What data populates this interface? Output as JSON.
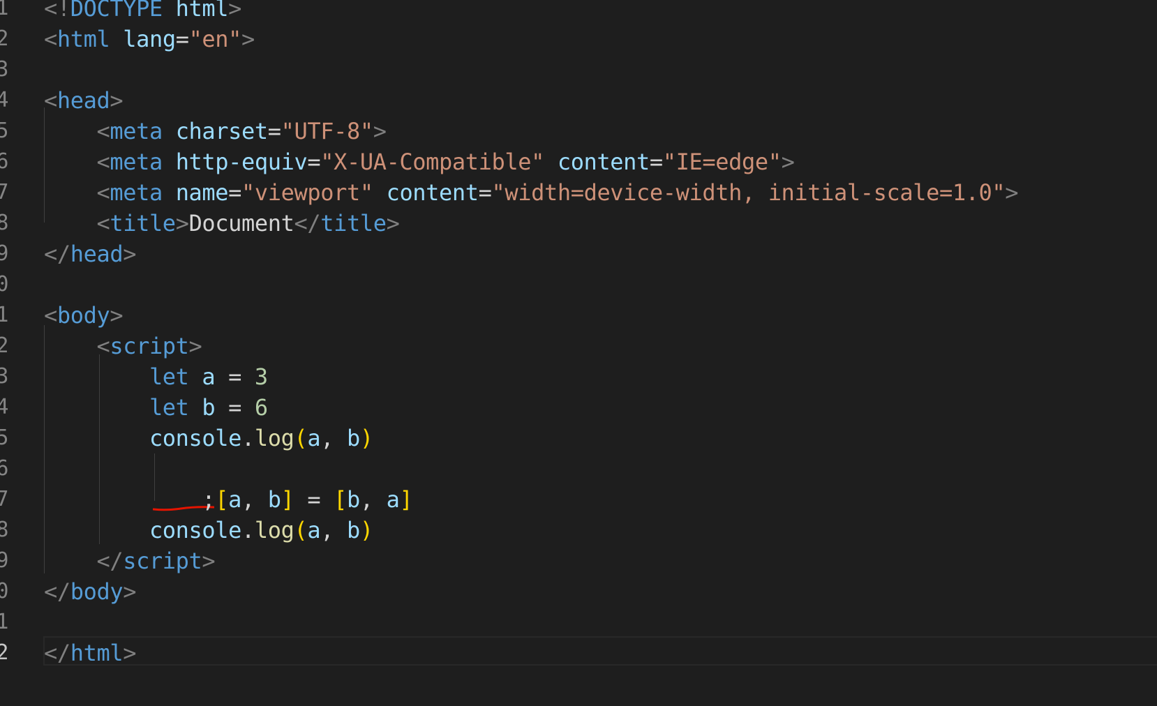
{
  "editor": {
    "active_line": "22",
    "line_numbers": [
      "1",
      "2",
      "3",
      "4",
      "5",
      "6",
      "7",
      "8",
      "9",
      "0",
      "1",
      "2",
      "3",
      "4",
      "5",
      "6",
      "7",
      "8",
      "9",
      "0",
      "1",
      "2"
    ],
    "lines": [
      [
        {
          "t": "<!",
          "c": "punc"
        },
        {
          "t": "DOCTYPE",
          "c": "tag"
        },
        {
          "t": " ",
          "c": "text"
        },
        {
          "t": "html",
          "c": "attr"
        },
        {
          "t": ">",
          "c": "punc"
        }
      ],
      [
        {
          "t": "<",
          "c": "punc"
        },
        {
          "t": "html",
          "c": "tag"
        },
        {
          "t": " ",
          "c": "text"
        },
        {
          "t": "lang",
          "c": "attr"
        },
        {
          "t": "=",
          "c": "text"
        },
        {
          "t": "\"en\"",
          "c": "str"
        },
        {
          "t": ">",
          "c": "punc"
        }
      ],
      [],
      [
        {
          "t": "<",
          "c": "punc"
        },
        {
          "t": "head",
          "c": "tag"
        },
        {
          "t": ">",
          "c": "punc"
        }
      ],
      [
        {
          "t": "    ",
          "c": "text"
        },
        {
          "t": "<",
          "c": "punc"
        },
        {
          "t": "meta",
          "c": "tag"
        },
        {
          "t": " ",
          "c": "text"
        },
        {
          "t": "charset",
          "c": "attr"
        },
        {
          "t": "=",
          "c": "text"
        },
        {
          "t": "\"UTF-8\"",
          "c": "str"
        },
        {
          "t": ">",
          "c": "punc"
        }
      ],
      [
        {
          "t": "    ",
          "c": "text"
        },
        {
          "t": "<",
          "c": "punc"
        },
        {
          "t": "meta",
          "c": "tag"
        },
        {
          "t": " ",
          "c": "text"
        },
        {
          "t": "http-equiv",
          "c": "attr"
        },
        {
          "t": "=",
          "c": "text"
        },
        {
          "t": "\"X-UA-Compatible\"",
          "c": "str"
        },
        {
          "t": " ",
          "c": "text"
        },
        {
          "t": "content",
          "c": "attr"
        },
        {
          "t": "=",
          "c": "text"
        },
        {
          "t": "\"IE=edge\"",
          "c": "str"
        },
        {
          "t": ">",
          "c": "punc"
        }
      ],
      [
        {
          "t": "    ",
          "c": "text"
        },
        {
          "t": "<",
          "c": "punc"
        },
        {
          "t": "meta",
          "c": "tag"
        },
        {
          "t": " ",
          "c": "text"
        },
        {
          "t": "name",
          "c": "attr"
        },
        {
          "t": "=",
          "c": "text"
        },
        {
          "t": "\"viewport\"",
          "c": "str"
        },
        {
          "t": " ",
          "c": "text"
        },
        {
          "t": "content",
          "c": "attr"
        },
        {
          "t": "=",
          "c": "text"
        },
        {
          "t": "\"width=device-width, initial-scale=1.0\"",
          "c": "str"
        },
        {
          "t": ">",
          "c": "punc"
        }
      ],
      [
        {
          "t": "    ",
          "c": "text"
        },
        {
          "t": "<",
          "c": "punc"
        },
        {
          "t": "title",
          "c": "tag"
        },
        {
          "t": ">",
          "c": "punc"
        },
        {
          "t": "Document",
          "c": "text"
        },
        {
          "t": "</",
          "c": "punc"
        },
        {
          "t": "title",
          "c": "tag"
        },
        {
          "t": ">",
          "c": "punc"
        }
      ],
      [
        {
          "t": "</",
          "c": "punc"
        },
        {
          "t": "head",
          "c": "tag"
        },
        {
          "t": ">",
          "c": "punc"
        }
      ],
      [],
      [
        {
          "t": "<",
          "c": "punc"
        },
        {
          "t": "body",
          "c": "tag"
        },
        {
          "t": ">",
          "c": "punc"
        }
      ],
      [
        {
          "t": "    ",
          "c": "text"
        },
        {
          "t": "<",
          "c": "punc"
        },
        {
          "t": "script",
          "c": "tag"
        },
        {
          "t": ">",
          "c": "punc"
        }
      ],
      [
        {
          "t": "        ",
          "c": "text"
        },
        {
          "t": "let",
          "c": "kw"
        },
        {
          "t": " ",
          "c": "text"
        },
        {
          "t": "a",
          "c": "var"
        },
        {
          "t": " = ",
          "c": "text"
        },
        {
          "t": "3",
          "c": "num"
        }
      ],
      [
        {
          "t": "        ",
          "c": "text"
        },
        {
          "t": "let",
          "c": "kw"
        },
        {
          "t": " ",
          "c": "text"
        },
        {
          "t": "b",
          "c": "var"
        },
        {
          "t": " = ",
          "c": "text"
        },
        {
          "t": "6",
          "c": "num"
        }
      ],
      [
        {
          "t": "        ",
          "c": "text"
        },
        {
          "t": "console",
          "c": "var"
        },
        {
          "t": ".",
          "c": "text"
        },
        {
          "t": "log",
          "c": "fn"
        },
        {
          "t": "(",
          "c": "br1"
        },
        {
          "t": "a",
          "c": "var"
        },
        {
          "t": ", ",
          "c": "text"
        },
        {
          "t": "b",
          "c": "var"
        },
        {
          "t": ")",
          "c": "br1"
        }
      ],
      [],
      [
        {
          "t": "            ",
          "c": "text"
        },
        {
          "t": ";",
          "c": "text"
        },
        {
          "t": "[",
          "c": "br1"
        },
        {
          "t": "a",
          "c": "var"
        },
        {
          "t": ", ",
          "c": "text"
        },
        {
          "t": "b",
          "c": "var"
        },
        {
          "t": "]",
          "c": "br1"
        },
        {
          "t": " = ",
          "c": "text"
        },
        {
          "t": "[",
          "c": "br1"
        },
        {
          "t": "b",
          "c": "var"
        },
        {
          "t": ", ",
          "c": "text"
        },
        {
          "t": "a",
          "c": "var"
        },
        {
          "t": "]",
          "c": "br1"
        }
      ],
      [
        {
          "t": "        ",
          "c": "text"
        },
        {
          "t": "console",
          "c": "var"
        },
        {
          "t": ".",
          "c": "text"
        },
        {
          "t": "log",
          "c": "fn"
        },
        {
          "t": "(",
          "c": "br1"
        },
        {
          "t": "a",
          "c": "var"
        },
        {
          "t": ", ",
          "c": "text"
        },
        {
          "t": "b",
          "c": "var"
        },
        {
          "t": ")",
          "c": "br1"
        }
      ],
      [
        {
          "t": "    ",
          "c": "text"
        },
        {
          "t": "</",
          "c": "punc"
        },
        {
          "t": "script",
          "c": "tag"
        },
        {
          "t": ">",
          "c": "punc"
        }
      ],
      [
        {
          "t": "</",
          "c": "punc"
        },
        {
          "t": "body",
          "c": "tag"
        },
        {
          "t": ">",
          "c": "punc"
        }
      ],
      [],
      [
        {
          "t": "</",
          "c": "punc"
        },
        {
          "t": "html",
          "c": "tag"
        },
        {
          "t": ">",
          "c": "punc"
        }
      ]
    ],
    "colors": {
      "background": "#1e1e1e",
      "error_squiggle": "#e51400",
      "indent_guide": "#404040"
    }
  }
}
